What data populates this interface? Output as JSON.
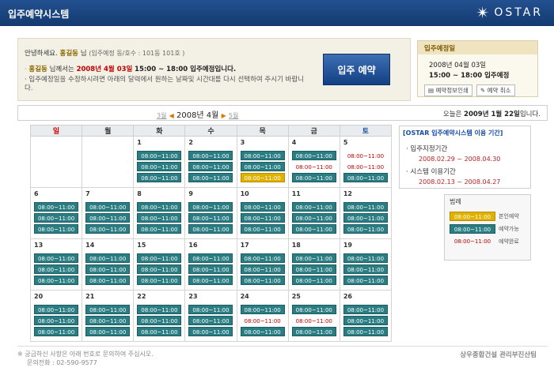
{
  "header": {
    "title": "입주예약시스템",
    "logo": "OSTAR"
  },
  "info": {
    "greeting_prefix": "안녕하세요.",
    "user_name": "홍길동",
    "greeting_suffix": "님",
    "unit_info": "(입주예정 동/호수 : 101동 101호 )",
    "line2_name": "홍길동",
    "line2_mid": "님께서는",
    "line2_date": "2008년 4월 03일",
    "line2_time": "15:00 ~ 18:00 입주예정입니다.",
    "line3": "입주예정일을 수정하시려면 아래의 달력에서 원하는 날짜및 시간대를 다시 선택하여 주시기 바랍니다.",
    "reserve_button": "입주 예약"
  },
  "scheduled": {
    "header": "입주예정일",
    "date": "2008년 04월 03일",
    "time": "15:00 ~ 18:00 입주예정",
    "print_button": "예약정보인쇄",
    "cancel_button": "예약 취소"
  },
  "nav": {
    "prev": "3월",
    "current": "2008년 4월",
    "next": "5월",
    "today_prefix": "오늘은",
    "today_date": "2009년 1월 22일",
    "today_suffix": "입니다."
  },
  "weekdays": [
    "일",
    "월",
    "화",
    "수",
    "목",
    "금",
    "토"
  ],
  "calendar": {
    "weeks": [
      [
        {
          "day": "",
          "slots": []
        },
        {
          "day": "",
          "slots": []
        },
        {
          "day": "1",
          "slots": [
            {
              "t": "08:00~11:00",
              "s": "avail"
            },
            {
              "t": "08:00~11:00",
              "s": "avail"
            },
            {
              "t": "08:00~11:00",
              "s": "avail"
            }
          ]
        },
        {
          "day": "2",
          "slots": [
            {
              "t": "08:00~11:00",
              "s": "avail"
            },
            {
              "t": "08:00~11:00",
              "s": "avail"
            },
            {
              "t": "08:00~11:00",
              "s": "avail"
            }
          ]
        },
        {
          "day": "3",
          "slots": [
            {
              "t": "08:00~11:00",
              "s": "avail"
            },
            {
              "t": "08:00~11:00",
              "s": "avail"
            },
            {
              "t": "08:00~11:00",
              "s": "mine"
            }
          ]
        },
        {
          "day": "4",
          "slots": [
            {
              "t": "08:00~11:00",
              "s": "avail"
            },
            {
              "t": "08:00~11:00",
              "s": "booked"
            },
            {
              "t": "08:00~11:00",
              "s": "avail"
            }
          ]
        },
        {
          "day": "5",
          "slots": [
            {
              "t": "08:00~11:00",
              "s": "booked"
            },
            {
              "t": "08:00~11:00",
              "s": "booked"
            },
            {
              "t": "08:00~11:00",
              "s": "avail"
            }
          ]
        }
      ],
      [
        {
          "day": "6",
          "slots": [
            {
              "t": "08:00~11:00",
              "s": "avail"
            },
            {
              "t": "08:00~11:00",
              "s": "avail"
            },
            {
              "t": "08:00~11:00",
              "s": "avail"
            }
          ]
        },
        {
          "day": "7",
          "slots": [
            {
              "t": "08:00~11:00",
              "s": "avail"
            },
            {
              "t": "08:00~11:00",
              "s": "avail"
            },
            {
              "t": "08:00~11:00",
              "s": "avail"
            }
          ]
        },
        {
          "day": "8",
          "slots": [
            {
              "t": "08:00~11:00",
              "s": "avail"
            },
            {
              "t": "08:00~11:00",
              "s": "avail"
            },
            {
              "t": "08:00~11:00",
              "s": "avail"
            }
          ]
        },
        {
          "day": "9",
          "slots": [
            {
              "t": "08:00~11:00",
              "s": "avail"
            },
            {
              "t": "08:00~11:00",
              "s": "avail"
            },
            {
              "t": "08:00~11:00",
              "s": "avail"
            }
          ]
        },
        {
          "day": "10",
          "slots": [
            {
              "t": "08:00~11:00",
              "s": "avail"
            },
            {
              "t": "08:00~11:00",
              "s": "avail"
            },
            {
              "t": "08:00~11:00",
              "s": "avail"
            }
          ]
        },
        {
          "day": "11",
          "slots": [
            {
              "t": "08:00~11:00",
              "s": "avail"
            },
            {
              "t": "08:00~11:00",
              "s": "avail"
            },
            {
              "t": "08:00~11:00",
              "s": "avail"
            }
          ]
        },
        {
          "day": "12",
          "slots": [
            {
              "t": "08:00~11:00",
              "s": "avail"
            },
            {
              "t": "08:00~11:00",
              "s": "avail"
            },
            {
              "t": "08:00~11:00",
              "s": "avail"
            }
          ]
        }
      ],
      [
        {
          "day": "13",
          "slots": [
            {
              "t": "08:00~11:00",
              "s": "avail"
            },
            {
              "t": "08:00~11:00",
              "s": "avail"
            },
            {
              "t": "08:00~11:00",
              "s": "avail"
            }
          ]
        },
        {
          "day": "14",
          "slots": [
            {
              "t": "08:00~11:00",
              "s": "avail"
            },
            {
              "t": "08:00~11:00",
              "s": "avail"
            },
            {
              "t": "08:00~11:00",
              "s": "avail"
            }
          ]
        },
        {
          "day": "15",
          "slots": [
            {
              "t": "08:00~11:00",
              "s": "avail"
            },
            {
              "t": "08:00~11:00",
              "s": "avail"
            },
            {
              "t": "08:00~11:00",
              "s": "avail"
            }
          ]
        },
        {
          "day": "16",
          "slots": [
            {
              "t": "08:00~11:00",
              "s": "avail"
            },
            {
              "t": "08:00~11:00",
              "s": "avail"
            },
            {
              "t": "08:00~11:00",
              "s": "avail"
            }
          ]
        },
        {
          "day": "17",
          "slots": [
            {
              "t": "08:00~11:00",
              "s": "avail"
            },
            {
              "t": "08:00~11:00",
              "s": "avail"
            },
            {
              "t": "08:00~11:00",
              "s": "avail"
            }
          ]
        },
        {
          "day": "18",
          "slots": [
            {
              "t": "08:00~11:00",
              "s": "avail"
            },
            {
              "t": "08:00~11:00",
              "s": "avail"
            },
            {
              "t": "08:00~11:00",
              "s": "avail"
            }
          ]
        },
        {
          "day": "19",
          "slots": [
            {
              "t": "08:00~11:00",
              "s": "avail"
            },
            {
              "t": "08:00~11:00",
              "s": "avail"
            },
            {
              "t": "08:00~11:00",
              "s": "avail"
            }
          ]
        }
      ],
      [
        {
          "day": "20",
          "slots": [
            {
              "t": "08:00~11:00",
              "s": "avail"
            },
            {
              "t": "08:00~11:00",
              "s": "avail"
            },
            {
              "t": "08:00~11:00",
              "s": "avail"
            }
          ]
        },
        {
          "day": "21",
          "slots": [
            {
              "t": "08:00~11:00",
              "s": "avail"
            },
            {
              "t": "08:00~11:00",
              "s": "avail"
            },
            {
              "t": "08:00~11:00",
              "s": "avail"
            }
          ]
        },
        {
          "day": "22",
          "slots": [
            {
              "t": "08:00~11:00",
              "s": "avail"
            },
            {
              "t": "08:00~11:00",
              "s": "avail"
            },
            {
              "t": "08:00~11:00",
              "s": "avail"
            }
          ]
        },
        {
          "day": "23",
          "slots": [
            {
              "t": "08:00~11:00",
              "s": "avail"
            },
            {
              "t": "08:00~11:00",
              "s": "avail"
            },
            {
              "t": "08:00~11:00",
              "s": "avail"
            }
          ]
        },
        {
          "day": "24",
          "slots": [
            {
              "t": "08:00~11:00",
              "s": "avail"
            },
            {
              "t": "08:00~11:00",
              "s": "booked"
            },
            {
              "t": "08:00~11:00",
              "s": "avail"
            }
          ]
        },
        {
          "day": "25",
          "slots": [
            {
              "t": "08:00~11:00",
              "s": "avail"
            },
            {
              "t": "08:00~11:00",
              "s": "booked"
            },
            {
              "t": "08:00~11:00",
              "s": "avail"
            }
          ]
        },
        {
          "day": "26",
          "slots": [
            {
              "t": "08:00~11:00",
              "s": "avail"
            },
            {
              "t": "08:00~11:00",
              "s": "avail"
            },
            {
              "t": "08:00~11:00",
              "s": "avail"
            }
          ]
        }
      ]
    ]
  },
  "periods": {
    "header": "[OSTAR 입주예약시스템 이용 기간]",
    "move_in_label": "입주지정기간",
    "move_in_range": "2008.02.29 ~ 2008.04.30",
    "system_label": "시스템 이용기간",
    "system_range": "2008.02.13 ~ 2008.04.27"
  },
  "legend": {
    "header": "범례",
    "mine_sample": "08:00~11:00",
    "mine_label": "본인예약",
    "avail_sample": "08:00~11:00",
    "avail_label": "예약가능",
    "booked_sample": "08:00~11:00",
    "booked_label": "예약완료"
  },
  "footer": {
    "note": "궁금하신 사항은 아래 번호로 문의하여 주십시오.",
    "phone": "문의전화 : 02-590-9577",
    "company": "상우종합건설 관리부진산팀"
  },
  "colors": {
    "header_bg": "#1f4a8a",
    "available": "#2a7d83",
    "mine": "#e0b200",
    "booked_text": "#c00000"
  }
}
